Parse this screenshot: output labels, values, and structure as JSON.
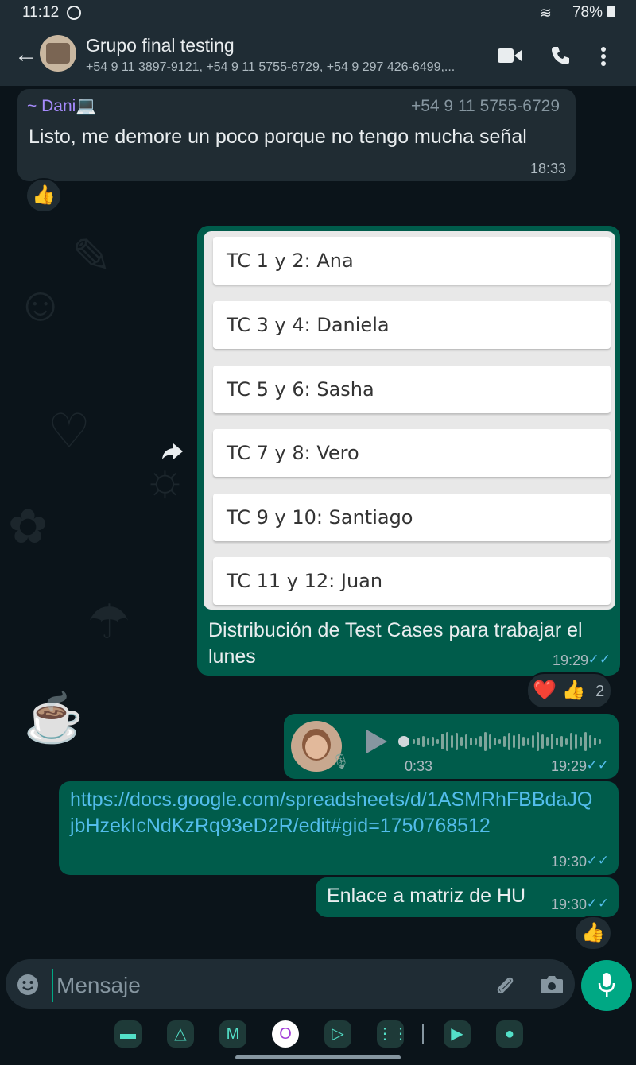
{
  "status_bar": {
    "time": "11:12",
    "battery": "78%"
  },
  "header": {
    "title": "Grupo final testing",
    "participants": "+54 9 11 3897-9121, +54 9 11 5755-6729, +54 9 297 426-6499,..."
  },
  "messages": {
    "m1": {
      "sender": "~ Dani💻",
      "phone": "+54 9 11 5755-6729",
      "text": "Listo, me demore un poco porque no tengo mucha señal",
      "time": "18:33",
      "reaction": "👍"
    },
    "m2": {
      "image_rows": [
        "TC 1 y 2: Ana",
        "TC 3 y 4: Daniela",
        "TC 5 y 6: Sasha",
        "TC 7 y 8: Vero",
        "TC 9 y 10: Santiago",
        "TC 11 y 12: Juan"
      ],
      "caption": "Distribución de Test Cases para trabajar el lunes",
      "time": "19:29",
      "reactions": "❤️ 👍",
      "reaction_count": "2"
    },
    "m3": {
      "duration": "0:33",
      "time": "19:29"
    },
    "m4": {
      "link": "https://docs.google.com/spreadsheets/d/1ASMRhFBBdaJQjbHzekIcNdKzRq93eD2R/edit#gid=1750768512",
      "time": "19:30"
    },
    "m5": {
      "text": "Enlace a matriz de HU",
      "time": "19:30",
      "reaction": "👍"
    }
  },
  "input": {
    "placeholder": "Mensaje"
  },
  "colors": {
    "outgoing": "#005c4b",
    "incoming": "#202c33",
    "accent": "#00a884",
    "read_ticks": "#53bdeb"
  },
  "icons": [
    "back-arrow-icon",
    "video-call-icon",
    "phone-icon",
    "more-vert-icon",
    "forward-icon",
    "play-icon",
    "mic-icon",
    "emoji-icon",
    "attach-icon",
    "camera-icon"
  ]
}
